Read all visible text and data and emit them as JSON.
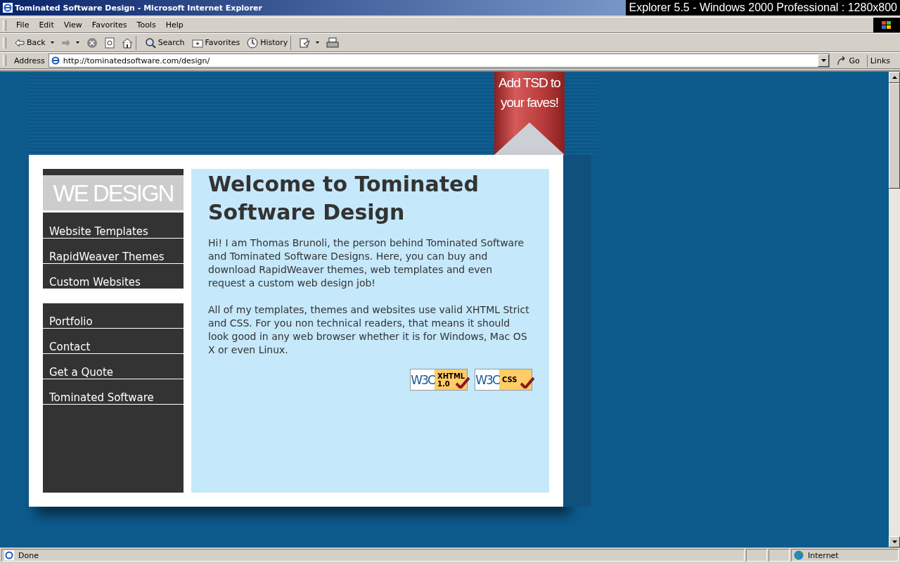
{
  "window": {
    "title": "Tominated Software Design - Microsoft Internet Explorer",
    "overlay_caption": "Explorer 5.5 - Windows 2000 Professional : 1280x800"
  },
  "menu": [
    "File",
    "Edit",
    "View",
    "Favorites",
    "Tools",
    "Help"
  ],
  "toolbar": [
    {
      "kind": "back",
      "label": "Back"
    },
    {
      "kind": "forward"
    },
    {
      "kind": "stop"
    },
    {
      "kind": "refresh"
    },
    {
      "kind": "home"
    },
    {
      "kind": "search",
      "label": "Search"
    },
    {
      "kind": "favorites",
      "label": "Favorites"
    },
    {
      "kind": "history",
      "label": "History"
    },
    {
      "kind": "mail"
    },
    {
      "kind": "print"
    }
  ],
  "address": {
    "label": "Address",
    "value": "http://tominatedsoftware.com/design/",
    "go": "Go",
    "links": "Links"
  },
  "ribbon": {
    "line1": "Add TSD to",
    "line2": "your faves!"
  },
  "page": {
    "logo": "WE DESIGN",
    "nav_groups": [
      [
        "Website Templates",
        "RapidWeaver Themes",
        "Custom Websites"
      ],
      [
        "Portfolio",
        "Contact",
        "Get a Quote",
        "Tominated Software"
      ]
    ],
    "heading": "Welcome to Tominated Software Design",
    "paragraphs": [
      "Hi! I am Thomas Brunoli, the person behind Tominated Software and Tominated Software Designs. Here, you can buy and download RapidWeaver themes, web templates and even request a custom web design job!",
      "All of my templates, themes and websites use valid XHTML Strict and CSS. For you non technical readers, that means it should look good in any web browser whether it is for Windows, Mac OS X or even Linux."
    ],
    "badges": [
      {
        "logo": "W3C",
        "line1": "XHTML",
        "line2": "1.0"
      },
      {
        "logo": "W3C",
        "line1": "CSS"
      }
    ]
  },
  "status_bar": {
    "text": "Done",
    "zone": "Internet"
  }
}
